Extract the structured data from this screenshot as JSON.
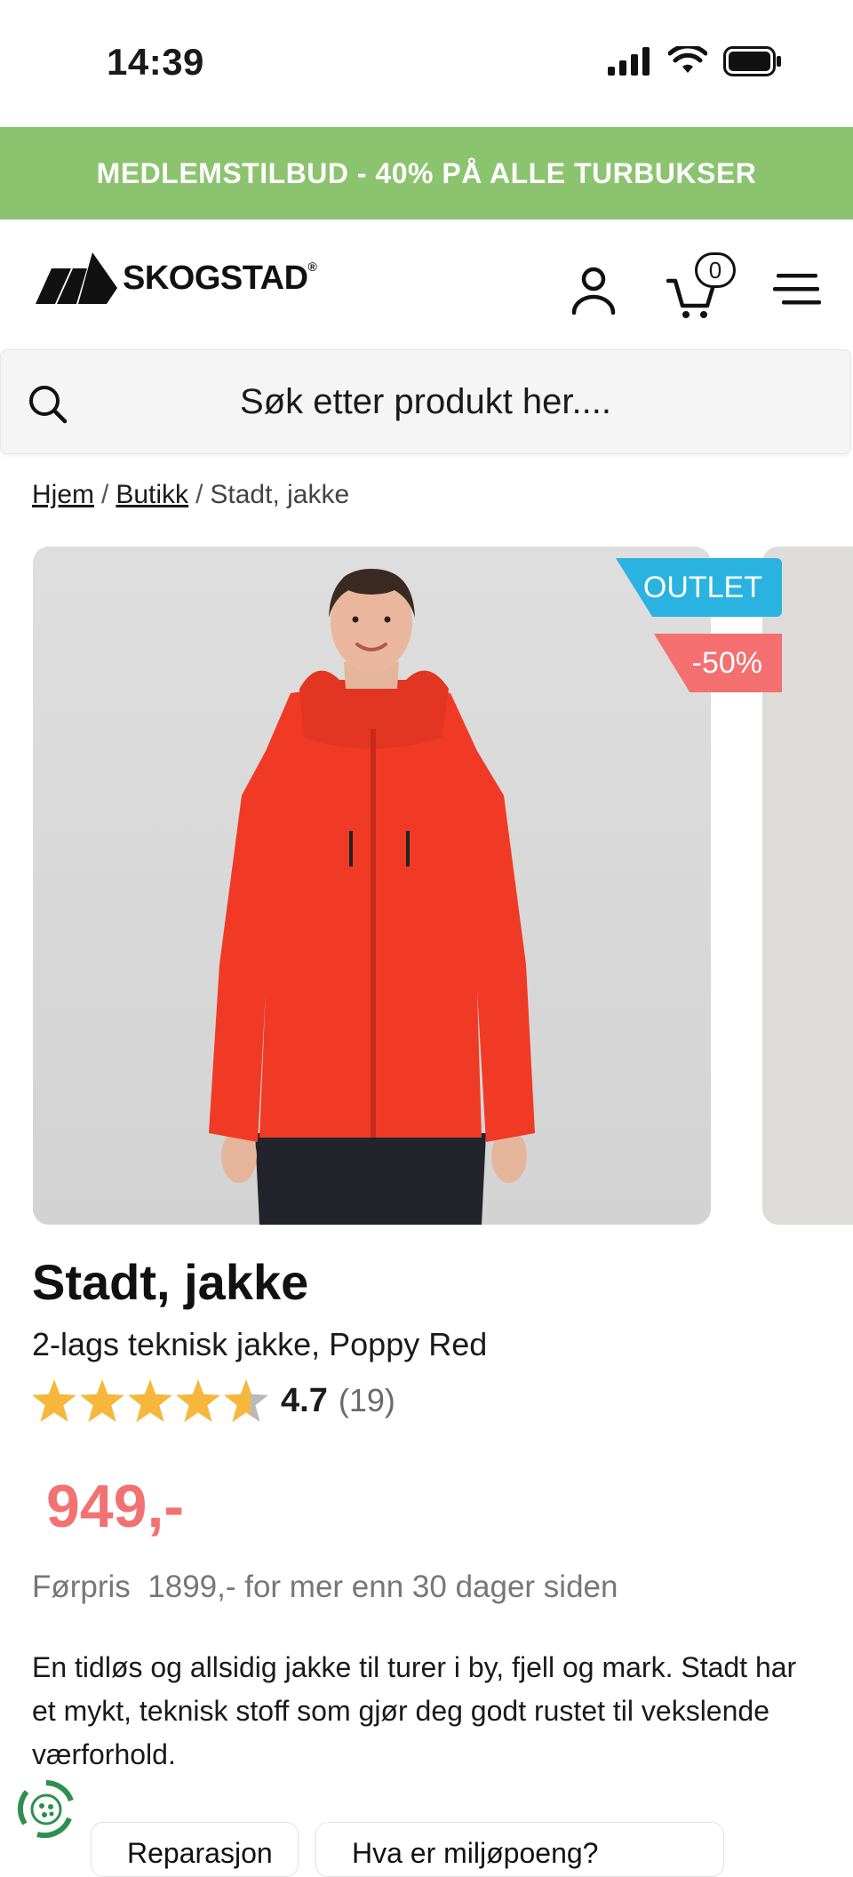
{
  "status_bar": {
    "time": "14:39"
  },
  "promo": {
    "text": "MEDLEMSTILBUD - 40% PÅ ALLE TURBUKSER"
  },
  "header": {
    "logo_text": "SKOGSTAD",
    "logo_reg": "®",
    "cart_count": "0"
  },
  "search": {
    "placeholder": "Søk etter produkt her...."
  },
  "breadcrumb": {
    "items": [
      "Hjem",
      "Butikk",
      "Stadt, jakke"
    ],
    "separator": "/"
  },
  "gallery": {
    "badges": {
      "outlet": "OUTLET",
      "discount": "-50%"
    },
    "colors": {
      "outlet": "#2ab3e1",
      "discount": "#f46f6f"
    }
  },
  "product": {
    "title": "Stadt, jakke",
    "subtitle": "2-lags teknisk jakke, Poppy Red",
    "rating": {
      "value": "4.7",
      "count": "(19)",
      "stars": 4.7,
      "max": 5
    },
    "price": "949,-",
    "previous_price": "Førpris  1899,- for mer enn 30 dager siden",
    "description": "En tidløs og allsidig jakke til turer i by, fjell og mark. Stadt har et mykt, teknisk stoff som gjør deg godt rustet til vekslende værforhold."
  },
  "bottom_chips": [
    "Reparasjon",
    "Hva er miljøpoeng?"
  ],
  "colors": {
    "promo_bg": "#8bc36e",
    "price": "#f27272",
    "star": "#f6b73c"
  }
}
